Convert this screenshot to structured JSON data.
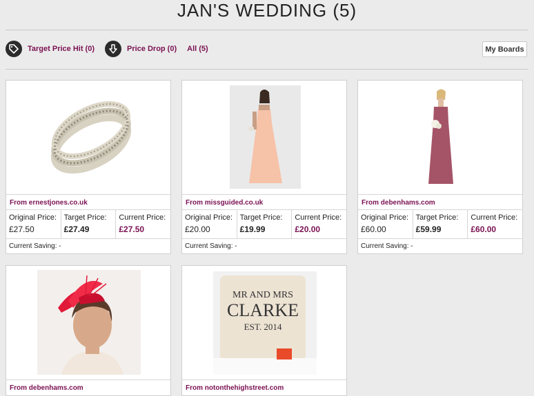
{
  "header": {
    "title": "JAN'S WEDDING (5)"
  },
  "filters": [
    {
      "label": "Target Price Hit (0)",
      "icon": "tag-icon"
    },
    {
      "label": "Price Drop (0)",
      "icon": "arrow-down-icon"
    },
    {
      "label": "All (5)"
    }
  ],
  "my_boards_label": "My Boards",
  "labels": {
    "original": "Original Price:",
    "target": "Target Price:",
    "current": "Current Price:",
    "saving": "Current Saving:"
  },
  "products": [
    {
      "source": "From ernestjones.co.uk",
      "original": "£27.50",
      "target": "£27.49",
      "current": "£27.50",
      "saving": "-",
      "image": "bracelet"
    },
    {
      "source": "From missguided.co.uk",
      "original": "£20.00",
      "target": "£19.99",
      "current": "£20.00",
      "saving": "-",
      "image": "peach-maxi-dress"
    },
    {
      "source": "From debenhams.com",
      "original": "£60.00",
      "target": "£59.99",
      "current": "£60.00",
      "saving": "-",
      "image": "pink-strapless-dress"
    },
    {
      "source": "From debenhams.com",
      "image": "red-fascinator"
    },
    {
      "source": "From notonthehighstreet.com",
      "image": "cushion",
      "cushion_text": [
        "MR AND MRS",
        "CLARKE",
        "EST. 2014"
      ]
    }
  ],
  "colors": {
    "accent": "#7a1152",
    "background": "#ebebeb"
  }
}
